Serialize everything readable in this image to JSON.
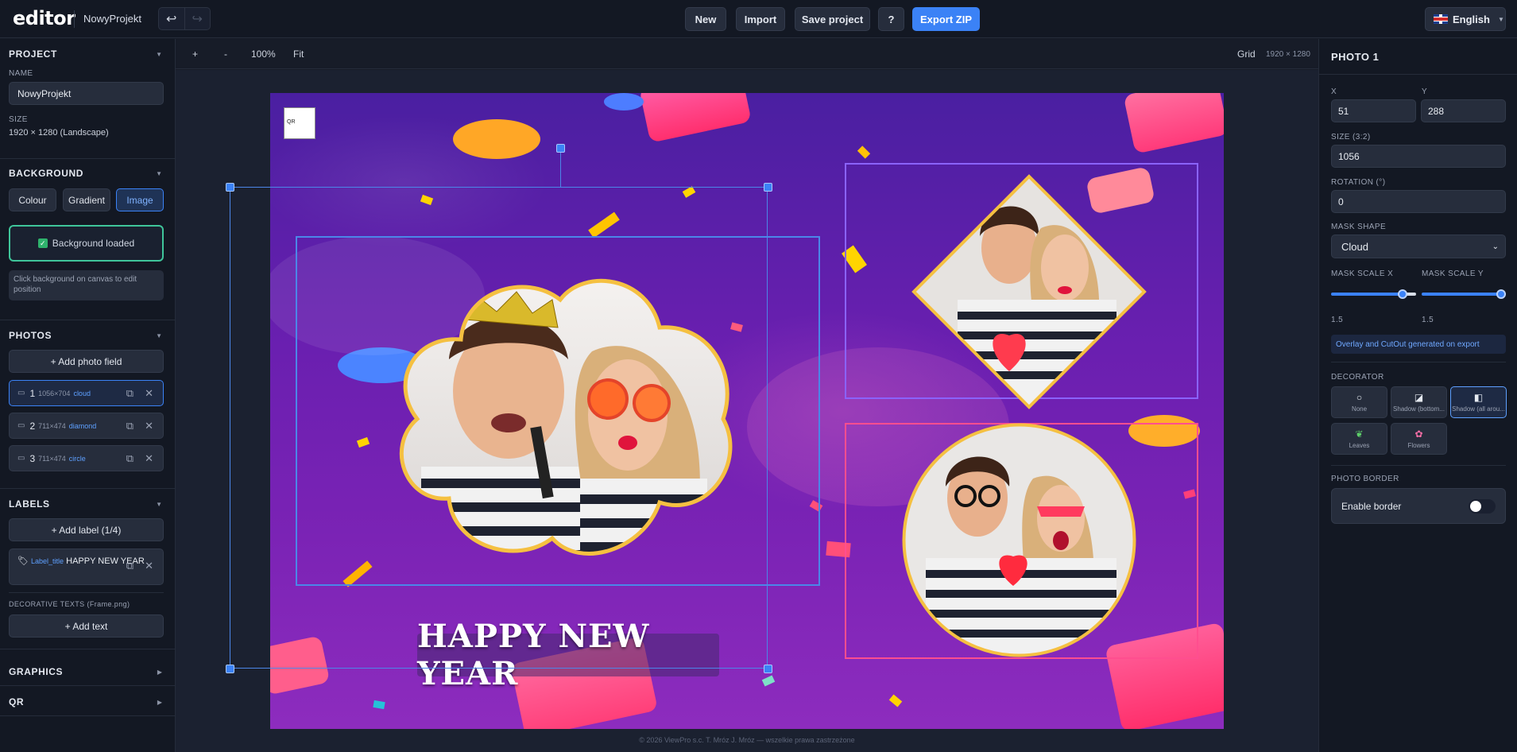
{
  "app": {
    "logo": "editor",
    "project_name": "NowyProjekt"
  },
  "toolbar": {
    "undo_icon": "undo-icon",
    "redo_icon": "redo-icon",
    "new_label": "New",
    "import_label": "Import",
    "save_label": "Save project",
    "help_label": "?",
    "export_label": "Export ZIP",
    "language": "English"
  },
  "left": {
    "project": {
      "title": "PROJECT",
      "name_label": "NAME",
      "name_value": "NowyProjekt",
      "size_label": "SIZE",
      "size_value": "1920 × 1280 (Landscape)"
    },
    "background": {
      "title": "BACKGROUND",
      "modes": [
        "Colour",
        "Gradient",
        "Image"
      ],
      "active_mode": "Image",
      "status": "Background loaded",
      "hint": "Click background on canvas to edit position"
    },
    "photos": {
      "title": "PHOTOS",
      "add_label": "+ Add photo field",
      "items": [
        {
          "index": "1",
          "dims": "1056×704",
          "shape": "cloud"
        },
        {
          "index": "2",
          "dims": "711×474",
          "shape": "diamond"
        },
        {
          "index": "3",
          "dims": "711×474",
          "shape": "circle"
        }
      ]
    },
    "labels": {
      "title": "LABELS",
      "add_label": "+ Add label (1/4)",
      "item_tag": "Label_title",
      "item_text": "HAPPY NEW YEAR",
      "decorative_title": "DECORATIVE TEXTS (Frame.png)",
      "add_text_label": "+ Add text"
    },
    "graphics_title": "GRAPHICS",
    "qr_title": "QR"
  },
  "canvas": {
    "zoom_in": "+",
    "zoom_out": "-",
    "zoom": "100%",
    "fit": "Fit",
    "grid": "Grid",
    "dims": "1920 × 1280",
    "title_text": "HAPPY NEW YEAR",
    "qr_label": "QR",
    "footer": "© 2026 ViewPro s.c. T. Mróz J. Mróz — wszelkie prawa zastrzeżone"
  },
  "right": {
    "title": "PHOTO 1",
    "x_label": "X",
    "x_value": "51",
    "y_label": "Y",
    "y_value": "288",
    "size_label": "SIZE (3:2)",
    "size_value": "1056",
    "rotation_label": "ROTATION (°)",
    "rotation_value": "0",
    "mask_shape_label": "MASK SHAPE",
    "mask_shape_value": "Cloud",
    "mask_scale_x_label": "MASK SCALE X",
    "mask_scale_x_value": "1.5",
    "mask_scale_y_label": "MASK SCALE Y",
    "mask_scale_y_value": "1.5",
    "note": "Overlay and CutOut generated on export",
    "decorator_label": "DECORATOR",
    "decorators": [
      {
        "label": "None",
        "icon": "circle-outline-icon"
      },
      {
        "label": "Shadow (bottom...",
        "icon": "shadow-bottom-icon"
      },
      {
        "label": "Shadow (all arou...",
        "icon": "shadow-all-icon"
      },
      {
        "label": "Leaves",
        "icon": "leaves-icon"
      },
      {
        "label": "Flowers",
        "icon": "flower-icon"
      }
    ],
    "active_decorator": "Shadow (all arou...",
    "border_label": "PHOTO BORDER",
    "enable_border": "Enable border"
  },
  "colors": {
    "accent": "#3b82f6",
    "success": "#3fc59a",
    "bg": "#161b26",
    "panel": "#131823"
  }
}
